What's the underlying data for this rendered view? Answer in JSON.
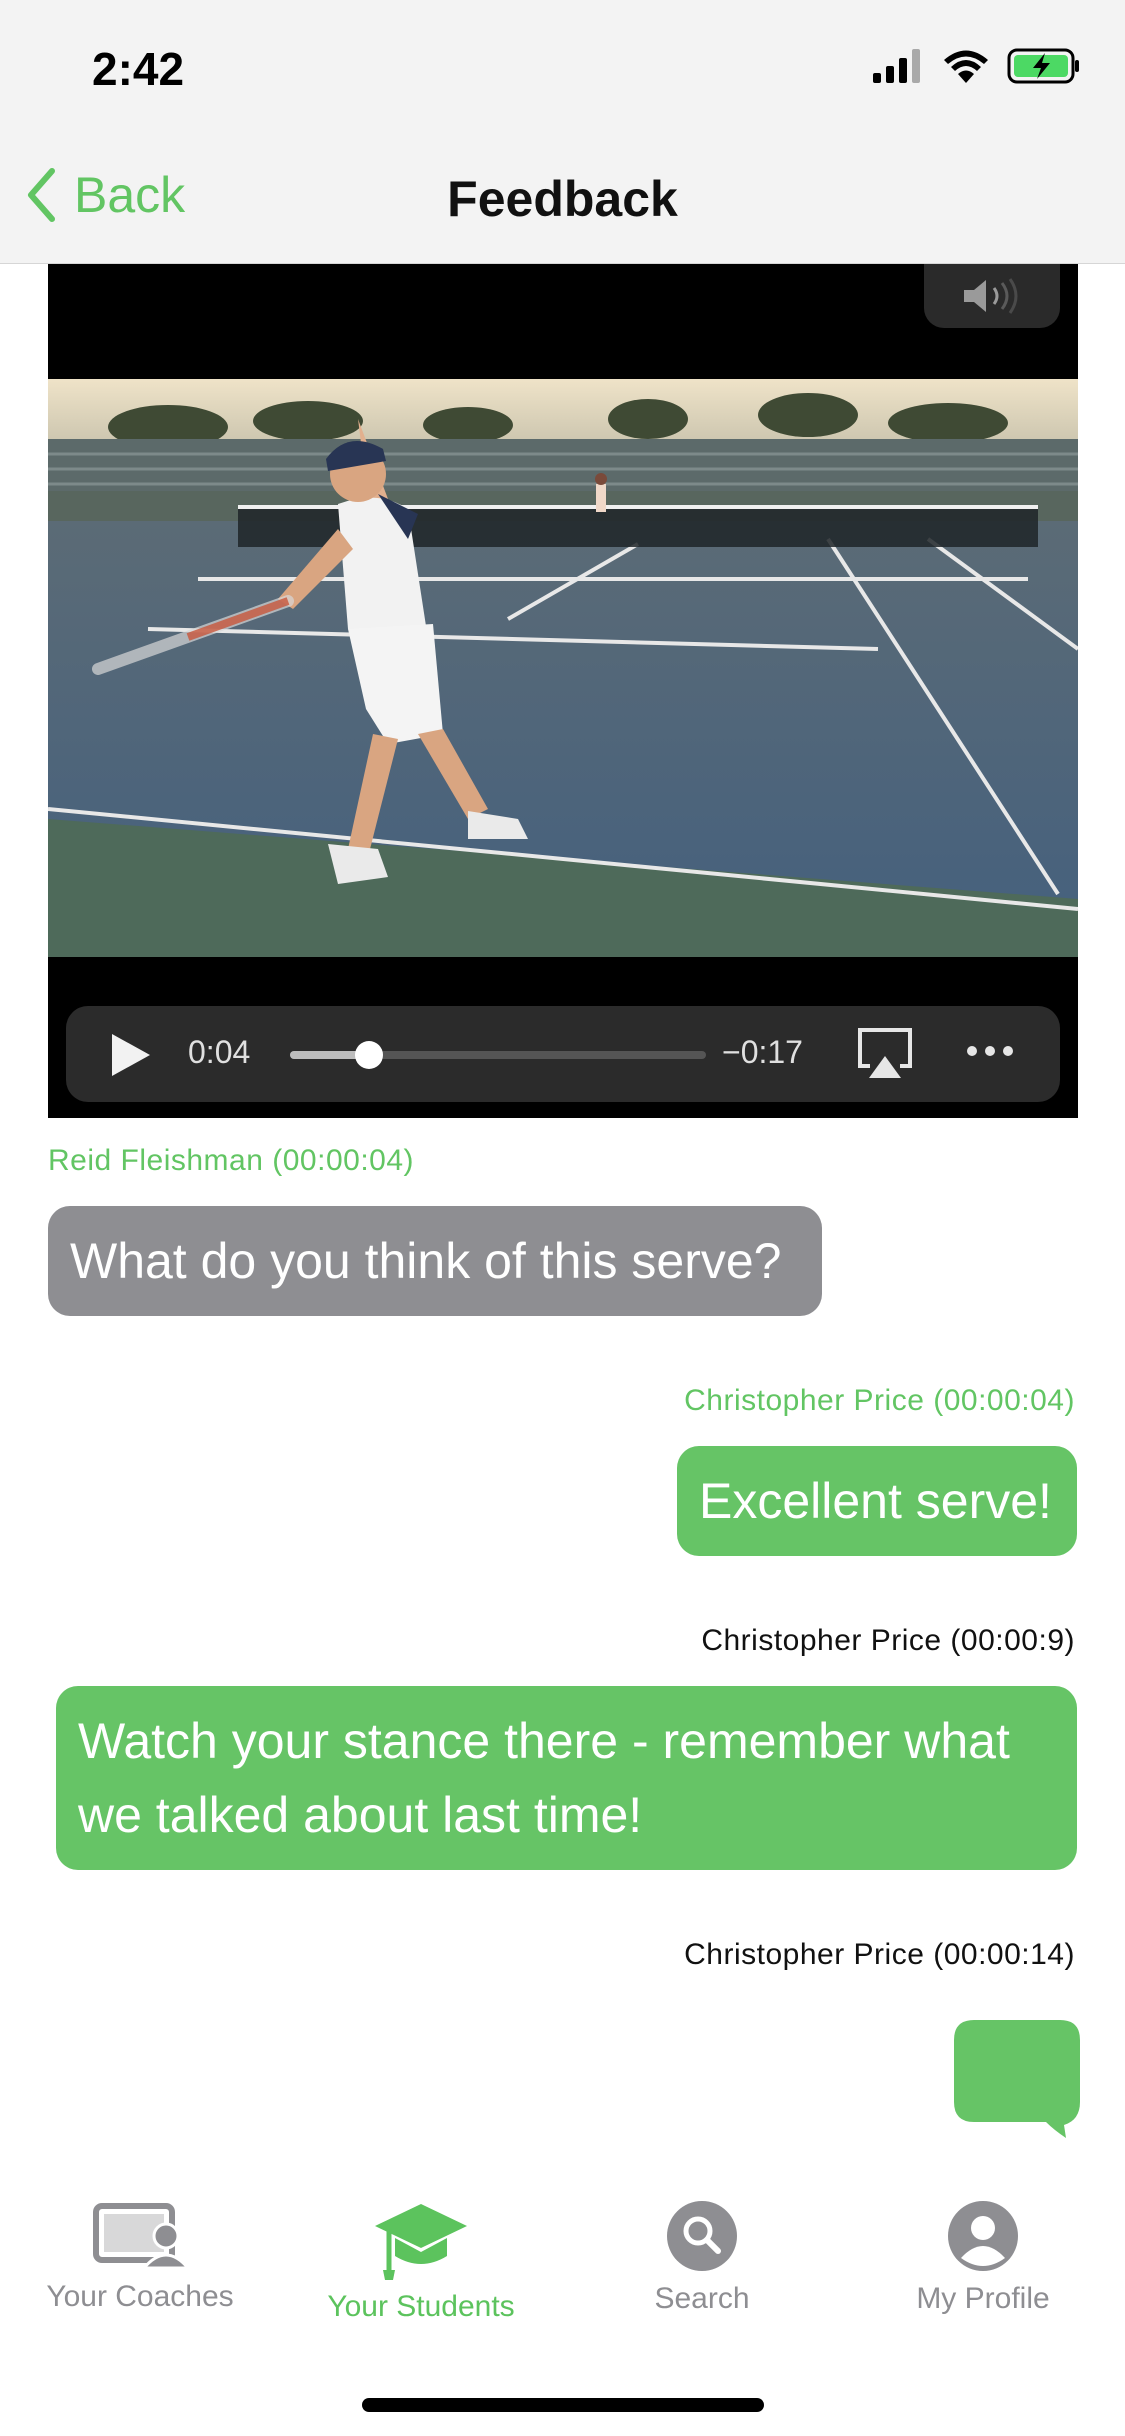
{
  "status_bar": {
    "time": "2:42"
  },
  "nav": {
    "back_label": "Back",
    "title": "Feedback"
  },
  "video": {
    "elapsed": "0:04",
    "remaining": "−0:17",
    "progress": 0.19
  },
  "messages": [
    {
      "author": "Reid Fleishman (00:00:04)",
      "text": "What do you think of this serve?"
    },
    {
      "author": "Christopher Price (00:00:04)",
      "text": "Excellent serve!"
    },
    {
      "author": "Christopher Price (00:00:9)",
      "text_line1": "Watch your stance there - remember what",
      "text_line2": "we talked about last time!"
    },
    {
      "author": "Christopher Price (00:00:14)",
      "text": ""
    }
  ],
  "tabs": [
    {
      "label": "Your Coaches",
      "icon": "coaches-icon"
    },
    {
      "label": "Your Students",
      "icon": "graduation-cap-icon"
    },
    {
      "label": "Search",
      "icon": "search-icon"
    },
    {
      "label": "My Profile",
      "icon": "profile-icon"
    }
  ],
  "colors": {
    "accent": "#62c563",
    "incoming_bubble": "#8e8e92",
    "outgoing_bubble": "#66c466"
  }
}
